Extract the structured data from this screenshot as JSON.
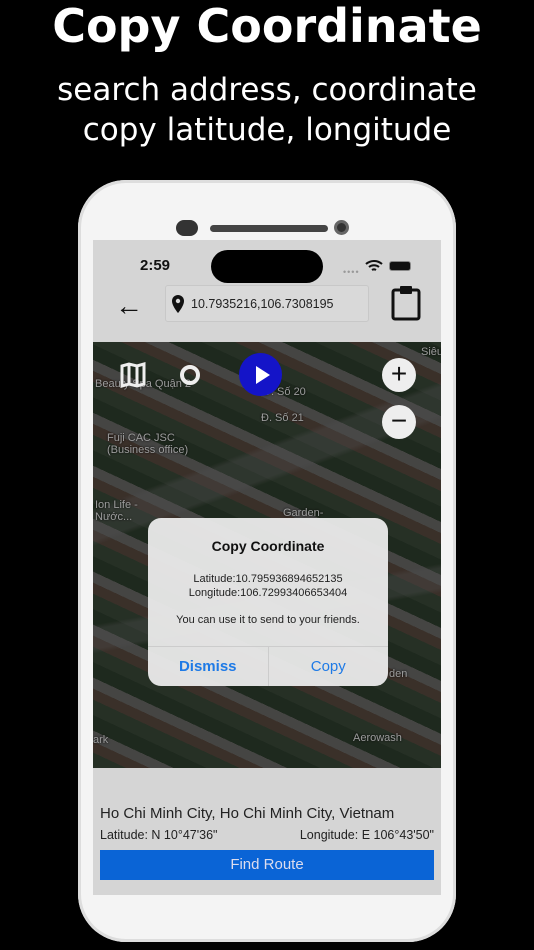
{
  "promo": {
    "title": "Copy Coordinate",
    "subtitle_line1": "search address, coordinate",
    "subtitle_line2": "copy latitude, longitude"
  },
  "status_bar": {
    "time": "2:59"
  },
  "nav": {
    "search_value": "10.7935216,106.7308195"
  },
  "map": {
    "labels": [
      "Beauty Spa Quận 2",
      "Fuji CAC JSC (Business office)",
      "Ion Life - Nước...",
      "Đ. Số 20",
      "Đ. Số 21",
      "Garden-",
      "Aerowash",
      "Siêu",
      "den",
      "ark"
    ]
  },
  "alert": {
    "title": "Copy Coordinate",
    "latitude": "Latitude:10.795936894652135",
    "longitude": "Longitude:106.72993406653404",
    "message": "You can use it to send to your friends.",
    "dismiss": "Dismiss",
    "copy": "Copy"
  },
  "panel": {
    "address": "Ho Chi Minh City, Ho Chi Minh City, Vietnam",
    "latitude": "Latitude: N 10°47'36\"",
    "longitude": "Longitude: E 106°43'50\"",
    "find_route": "Find Route"
  },
  "colors": {
    "accent": "#0a64d6",
    "play": "#1414c8",
    "alert_button": "#1e7ae6"
  }
}
